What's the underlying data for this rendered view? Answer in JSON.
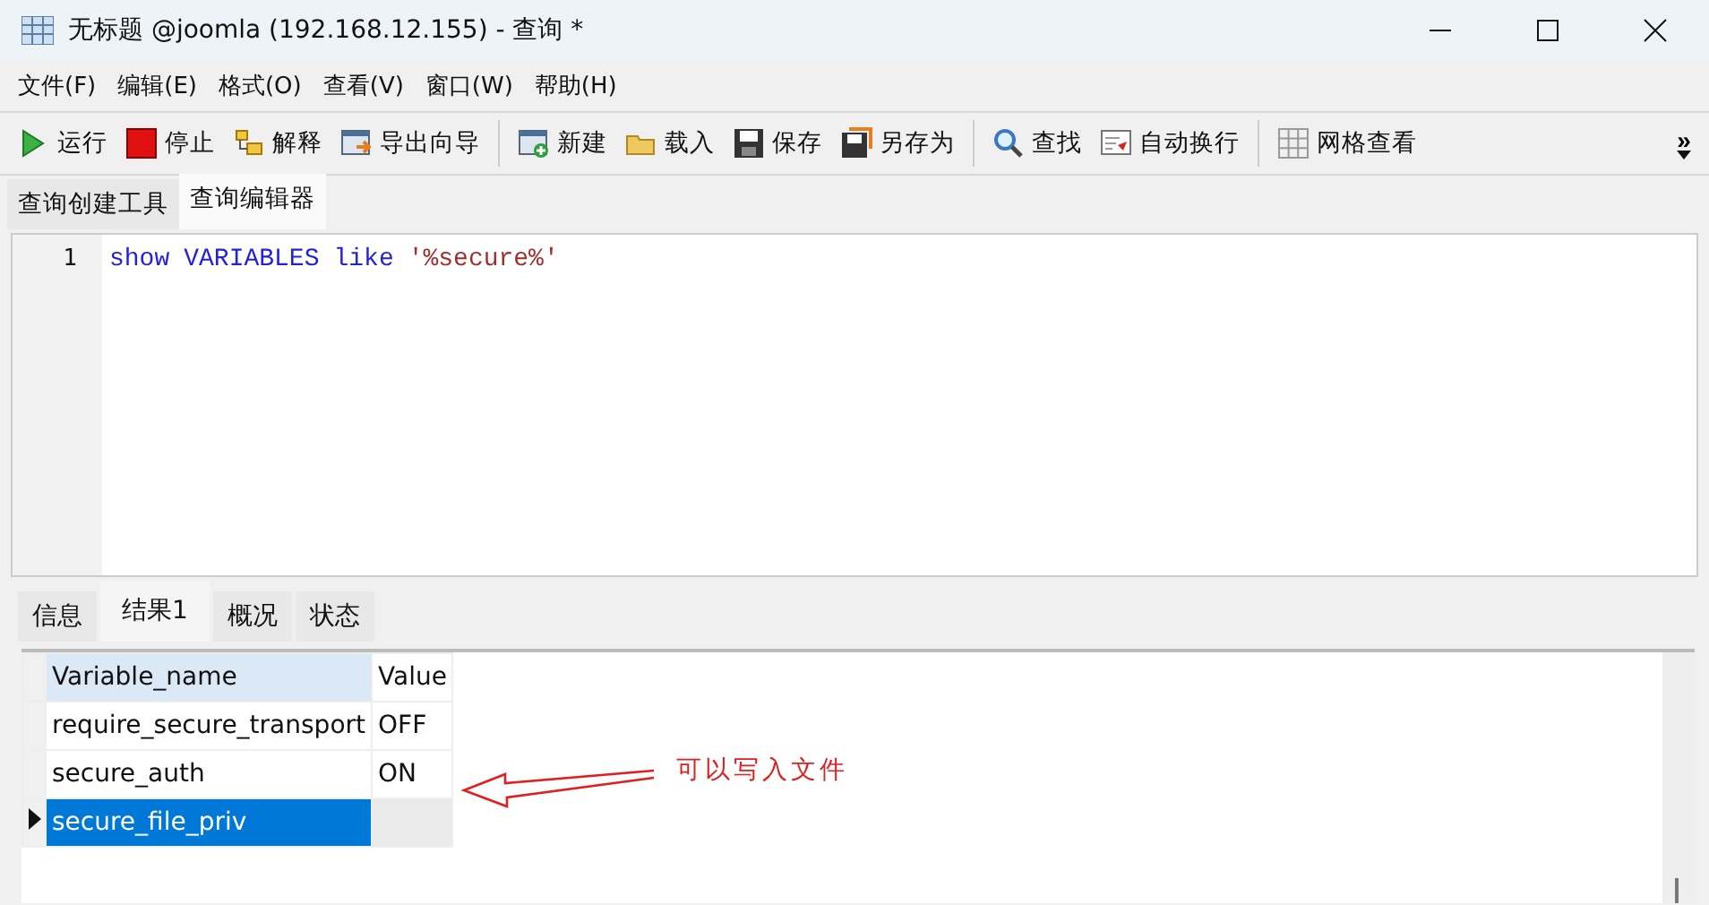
{
  "window": {
    "title": "无标题 @joomla (192.168.12.155) - 查询 *"
  },
  "menu": [
    "文件(F)",
    "编辑(E)",
    "格式(O)",
    "查看(V)",
    "窗口(W)",
    "帮助(H)"
  ],
  "toolbar": [
    [
      {
        "kind": "run",
        "label": "运行"
      },
      {
        "kind": "stop",
        "label": "停止"
      },
      {
        "kind": "explain",
        "label": "解释"
      },
      {
        "kind": "export",
        "label": "导出向导"
      }
    ],
    [
      {
        "kind": "new",
        "label": "新建"
      },
      {
        "kind": "open",
        "label": "载入"
      },
      {
        "kind": "save",
        "label": "保存"
      },
      {
        "kind": "saveas",
        "label": "另存为"
      }
    ],
    [
      {
        "kind": "find",
        "label": "查找"
      },
      {
        "kind": "wrap",
        "label": "自动换行"
      }
    ],
    [
      {
        "kind": "grid",
        "label": "网格查看"
      }
    ]
  ],
  "overflow": "»",
  "editor_tabs": [
    {
      "label": "查询创建工具",
      "selected": false
    },
    {
      "label": "查询编辑器",
      "selected": true
    }
  ],
  "editor": {
    "lines": [
      {
        "number": "1",
        "tokens": [
          {
            "kind": "keyword",
            "text": "show"
          },
          {
            "kind": "keyword",
            "text": "VARIABLES"
          },
          {
            "kind": "keyword",
            "text": "like"
          },
          {
            "kind": "string",
            "text": "'%secure%'"
          }
        ]
      }
    ]
  },
  "result_tabs": [
    {
      "label": "信息",
      "selected": false
    },
    {
      "label": "结果1",
      "selected": true
    },
    {
      "label": "概况",
      "selected": false
    },
    {
      "label": "状态",
      "selected": false
    }
  ],
  "table": {
    "columns": [
      "Variable_name",
      "Value"
    ],
    "rows": [
      {
        "cells": [
          "require_secure_transport",
          "OFF"
        ],
        "selected": false
      },
      {
        "cells": [
          "secure_auth",
          "ON"
        ],
        "selected": false
      },
      {
        "cells": [
          "secure_file_priv",
          ""
        ],
        "selected": true
      }
    ]
  },
  "annotation": {
    "text": "可以写入文件"
  }
}
